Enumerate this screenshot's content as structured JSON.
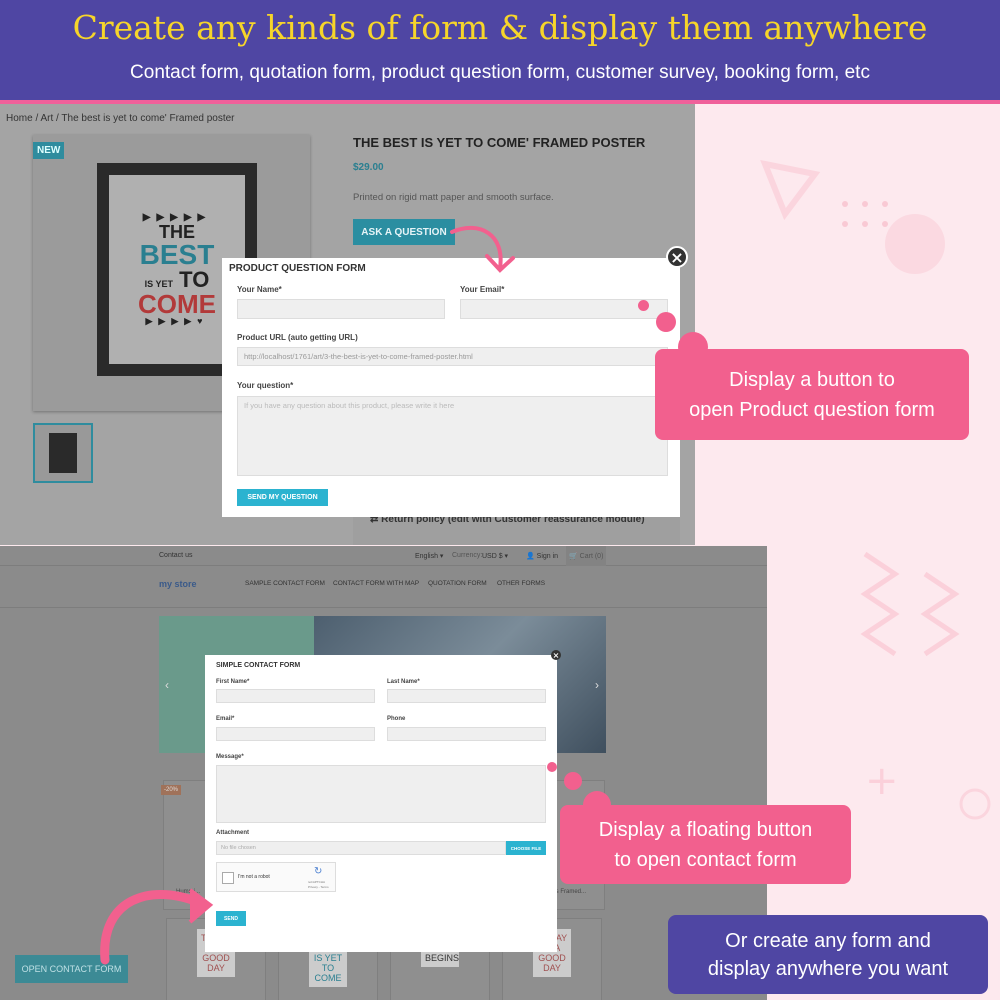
{
  "header": {
    "title": "Create any kinds of form & display them anywhere",
    "subtitle": "Contact form, quotation form, product question form, customer survey, booking form, etc"
  },
  "product_page": {
    "breadcrumb": [
      "Home",
      "Art",
      "The best is yet to come' Framed poster"
    ],
    "badge": "NEW",
    "title": "THE BEST IS YET TO COME' FRAMED POSTER",
    "price": "$29.00",
    "description": "Printed on rigid matt paper and smooth surface.",
    "ask_button": "ASK A QUESTION",
    "poster_text": [
      "THE",
      "BEST",
      "IS YET",
      "TO",
      "COME"
    ],
    "policy": "Return policy (edit with Customer reassurance module)"
  },
  "product_form": {
    "title": "PRODUCT QUESTION FORM",
    "name_label": "Your Name*",
    "email_label": "Your Email*",
    "url_label": "Product URL (auto getting URL)",
    "url_value": "http://localhost/1761/art/3-the-best-is-yet-to-come-framed-poster.html",
    "question_label": "Your question*",
    "question_placeholder": "If you have any question about this product, please write it here",
    "submit": "SEND MY QUESTION",
    "close": "×"
  },
  "store": {
    "contact_link": "Contact us",
    "language": "English ▾",
    "currency_label": "Currency:",
    "currency": "USD $ ▾",
    "sign_in": "Sign in",
    "cart": "Cart (0)",
    "logo": "my store",
    "nav": [
      "SAMPLE CONTACT FORM",
      "CONTACT FORM WITH MAP",
      "QUOTATION FORM",
      "OTHER FORMS"
    ],
    "discount_badge": "-20%",
    "product_names": [
      "Hummi...",
      "...ins Framed..."
    ],
    "open_contact_button": "OPEN CONTACT FORM",
    "mug_texts": [
      "TODAY IS A GOOD DAY",
      "THE BEST IS YET TO COME",
      "The Adventure BEGINS",
      "TODAY IS A GOOD DAY"
    ]
  },
  "contact_form": {
    "title": "SIMPLE CONTACT FORM",
    "first_name": "First Name*",
    "last_name": "Last Name*",
    "email": "Email*",
    "phone": "Phone",
    "message": "Message*",
    "attachment": "Attachment",
    "file_placeholder": "No file chosen",
    "choose_file": "CHOOSE FILE",
    "captcha": "I'm not a robot",
    "captcha_brand": "reCAPTCHA",
    "captcha_links": "Privacy - Terms",
    "send": "SEND",
    "close": "×"
  },
  "callouts": {
    "product": [
      "Display a button to",
      "open Product question form"
    ],
    "floating": [
      "Display a floating button",
      "to open contact form"
    ],
    "anywhere": [
      "Or create any form and",
      "display anywhere you want"
    ]
  },
  "colors": {
    "header": "#4f46a3",
    "title": "#f6d52a",
    "accent_pink": "#f2608e",
    "form_button": "#2bb3d0"
  }
}
